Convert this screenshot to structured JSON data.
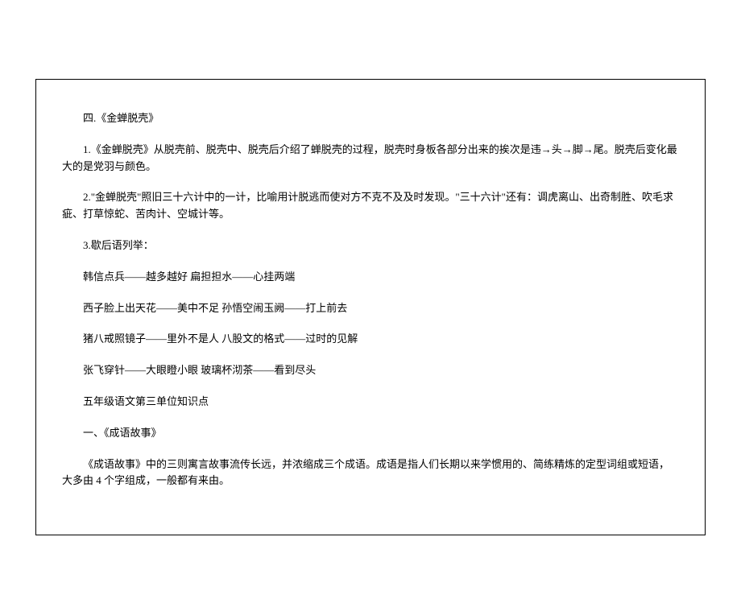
{
  "paragraphs": [
    "四.《金蝉脱壳》",
    "1.《金蝉脱壳》从脱壳前、脱壳中、脱壳后介绍了蝉脱壳的过程，脱壳时身板各部分出来的挨次是违→头→脚→尾。脱壳后变化最大的是党羽与颜色。",
    "2.\"金蝉脱壳\"照旧三十六计中的一计，比喻用计脱逃而使对方不克不及及时发现。\"三十六计\"还有：调虎离山、出奇制胜、吹毛求疵、打草惊蛇、苦肉计、空城计等。",
    "3.歇后语列举：",
    "韩信点兵——越多越好  扁担担水——心挂两端",
    "西子脸上出天花——美中不足  孙悟空闹玉阙——打上前去",
    "猪八戒照镜子——里外不是人  八股文的格式——过时的见解",
    "张飞穿针——大眼瞪小眼  玻璃杯沏茶——看到尽头",
    "五年级语文第三单位知识点",
    "一、《成语故事》",
    "《成语故事》中的三则寓言故事流传长远，并浓缩成三个成语。成语是指人们长期以来学惯用的、简练精炼的定型词组或短语，大多由 4 个字组成，一般都有来由。"
  ]
}
